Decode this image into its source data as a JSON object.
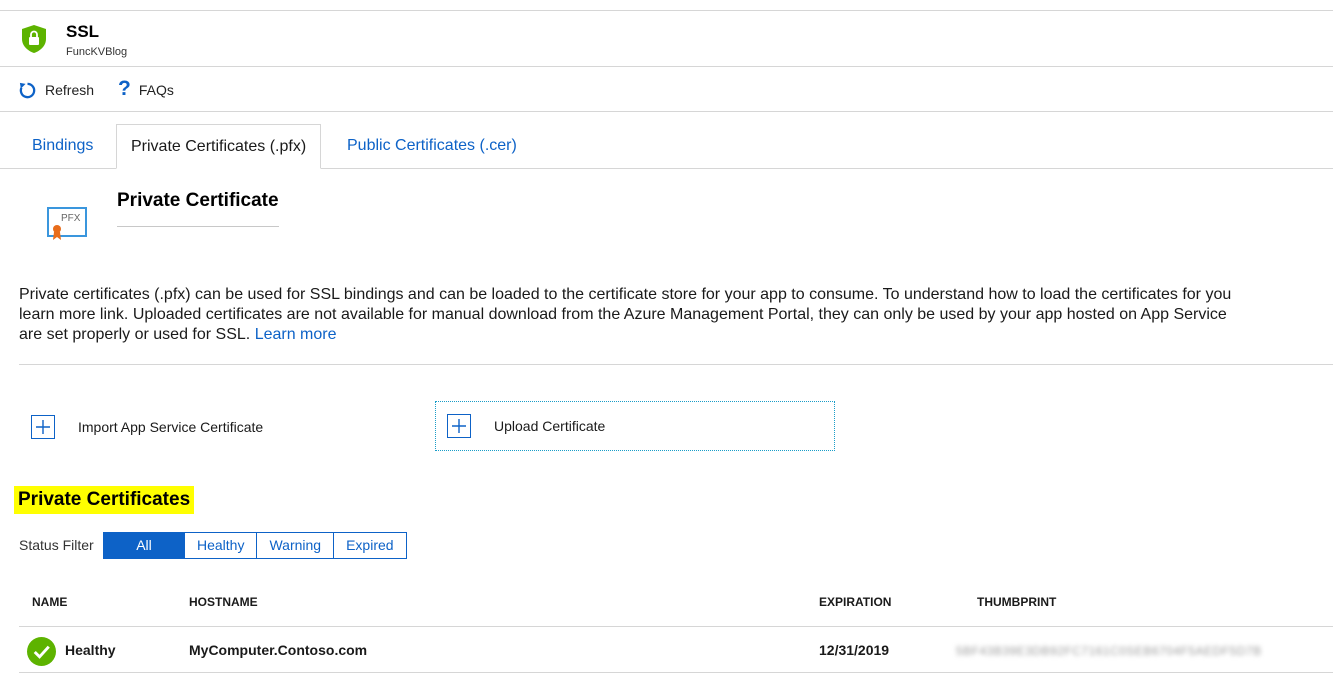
{
  "header": {
    "title": "SSL",
    "subtitle": "FuncKVBlog",
    "icon": "shield-lock-icon",
    "icon_color": "#5db300"
  },
  "toolbar": {
    "refresh_label": "Refresh",
    "faqs_label": "FAQs"
  },
  "tabs": [
    {
      "label": "Bindings",
      "active": false
    },
    {
      "label": "Private Certificates (.pfx)",
      "active": true
    },
    {
      "label": "Public Certificates (.cer)",
      "active": false
    }
  ],
  "section": {
    "icon_text": "PFX",
    "title": "Private Certificate",
    "description_lines": [
      "Private certificates (.pfx) can be used for SSL bindings and can be loaded to the certificate store for your app to consume. To understand how to load the certificates for you",
      "learn more link. Uploaded certificates are not available for manual download from the Azure Management Portal, they can only be used by your app hosted on App Service",
      "are set properly or used for SSL."
    ],
    "learn_more": "Learn more"
  },
  "actions": {
    "import_label": "Import App Service Certificate",
    "upload_label": "Upload Certificate"
  },
  "certificates": {
    "heading": "Private Certificates",
    "filter_label": "Status Filter",
    "filters": [
      {
        "label": "All",
        "active": true
      },
      {
        "label": "Healthy",
        "active": false
      },
      {
        "label": "Warning",
        "active": false
      },
      {
        "label": "Expired",
        "active": false
      }
    ],
    "columns": {
      "name": "NAME",
      "hostname": "HOSTNAME",
      "expiration": "EXPIRATION",
      "thumbprint": "THUMBPRINT"
    },
    "rows": [
      {
        "status": "Healthy",
        "hostname": "MyComputer.Contoso.com",
        "expiration": "12/31/2019",
        "thumbprint": "5BF43B39E3DB92FC7161C0SEB6704F5AEDF5D7B"
      }
    ]
  },
  "colors": {
    "accent": "#0d62c7",
    "healthy": "#5db300",
    "highlight": "#ffff00"
  }
}
